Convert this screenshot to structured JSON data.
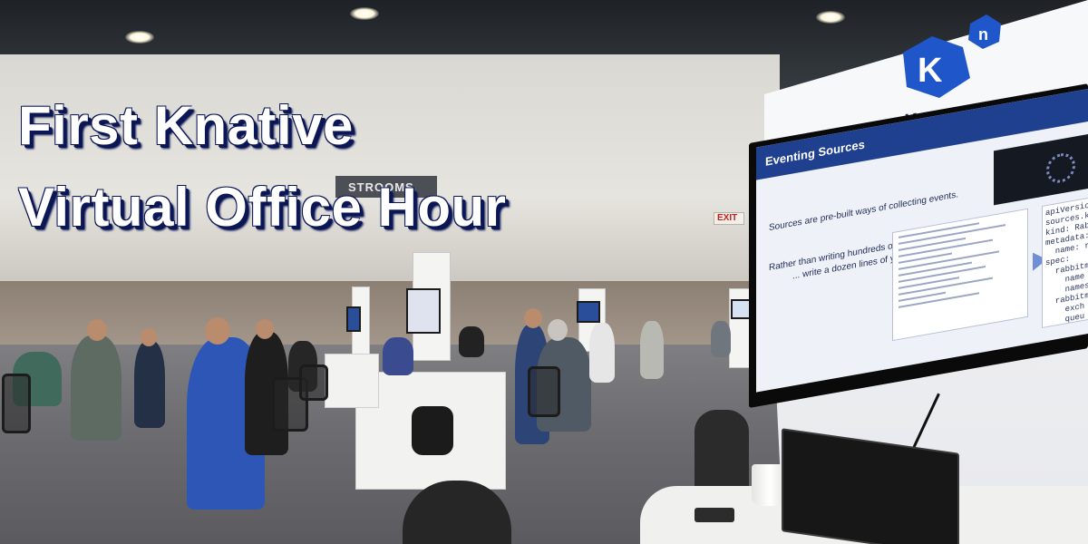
{
  "headline": {
    "line1": "First Knative",
    "line2": "Virtual Office Hour"
  },
  "logo": {
    "text": "Knative",
    "mark": "Kn"
  },
  "signs": {
    "restrooms": "STROOMS",
    "exit": "EXIT"
  },
  "slide": {
    "title": "Eventing Sources",
    "line1": "Sources are pre-built ways of collecting events.",
    "line2": "Rather than writing hundreds of lines of code",
    "line3": "... write a dozen lines of yaml!",
    "yaml": "apiVersio\nsources.kn\nkind: Rabb\nmetadata:\n  name: r\nspec:\n  rabbitm\n    name\n    names\n  rabbitm\n    exch\n    queu\n  sink\n    ref\nevents\n  ap\nAlso"
  },
  "colors": {
    "headline_text": "#ffffff",
    "headline_shadow": "#0b1655",
    "knative_blue": "#1f56c9",
    "slide_bar": "#1f3f8f"
  }
}
